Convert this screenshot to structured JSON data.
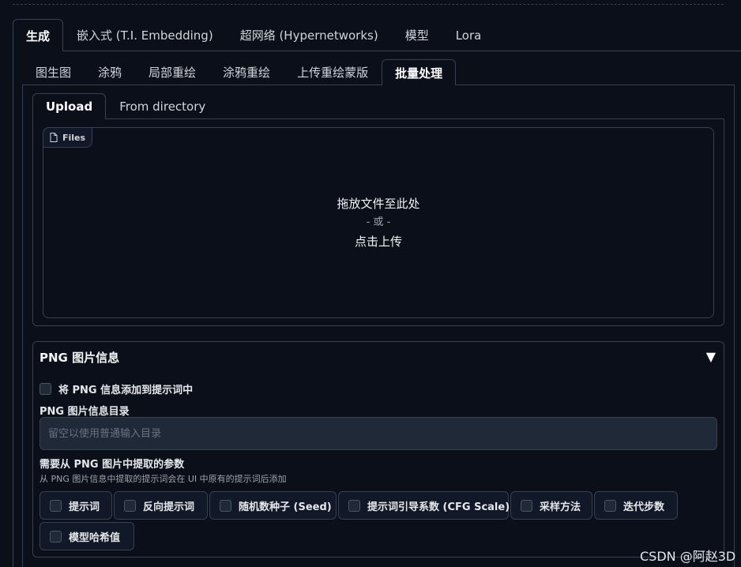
{
  "main_tabs": [
    {
      "label": "生成",
      "active": true
    },
    {
      "label": "嵌入式 (T.I. Embedding)",
      "active": false
    },
    {
      "label": "超网络 (Hypernetworks)",
      "active": false
    },
    {
      "label": "模型",
      "active": false
    },
    {
      "label": "Lora",
      "active": false
    }
  ],
  "sub_tabs": [
    {
      "label": "图生图",
      "active": false
    },
    {
      "label": "涂鸦",
      "active": false
    },
    {
      "label": "局部重绘",
      "active": false
    },
    {
      "label": "涂鸦重绘",
      "active": false
    },
    {
      "label": "上传重绘蒙版",
      "active": false
    },
    {
      "label": "批量处理",
      "active": true
    }
  ],
  "upload_tabs": [
    {
      "label": "Upload",
      "active": true
    },
    {
      "label": "From directory",
      "active": false
    }
  ],
  "dropzone": {
    "badge": "Files",
    "line1": "拖放文件至此处",
    "line2": "- 或 -",
    "line3": "点击上传"
  },
  "png_info": {
    "title": "PNG 图片信息",
    "caret": "▼",
    "add_checkbox_label": "将 PNG 信息添加到提示词中",
    "dir_label": "PNG 图片信息目录",
    "dir_placeholder": "留空以使用普通输入目录",
    "dir_value": "",
    "params_label": "需要从 PNG 图片中提取的参数",
    "params_sublabel": "从 PNG 图片信息中提取的提示词会在 UI 中原有的提示词后添加",
    "params": [
      {
        "label": "提示词",
        "checked": false
      },
      {
        "label": "反向提示词",
        "checked": false
      },
      {
        "label": "随机数种子 (Seed)",
        "checked": false
      },
      {
        "label": "提示词引导系数 (CFG Scale)",
        "checked": false
      },
      {
        "label": "采样方法",
        "checked": false
      },
      {
        "label": "迭代步数",
        "checked": false
      },
      {
        "label": "模型哈希值",
        "checked": false
      }
    ]
  },
  "watermark": "CSDN @阿赵3D",
  "colors": {
    "background": "#0b0f19",
    "border": "#374151",
    "input_bg": "#1f2937"
  }
}
